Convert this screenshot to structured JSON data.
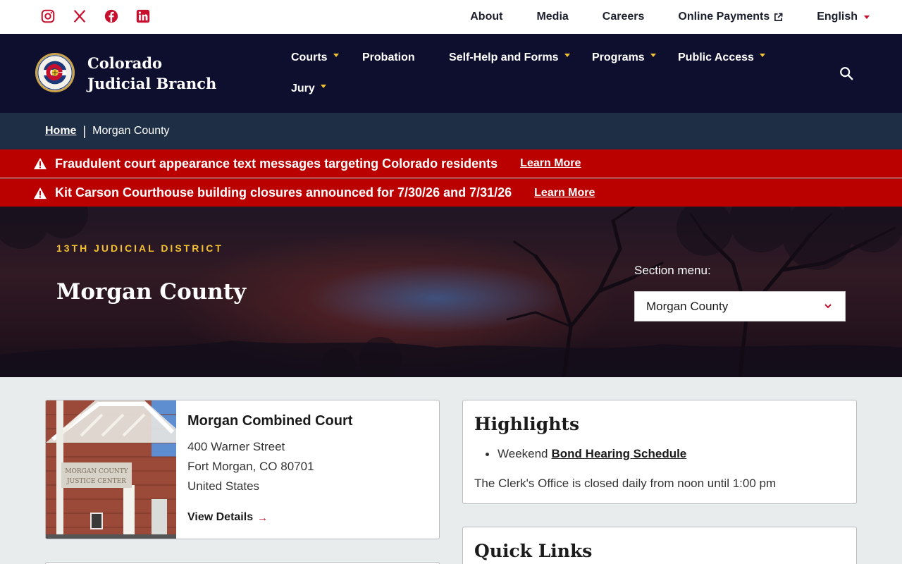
{
  "utility": {
    "social": [
      "instagram-icon",
      "x-icon",
      "facebook-icon",
      "linkedin-icon"
    ],
    "links": [
      "About",
      "Media",
      "Careers",
      "Online Payments",
      "English"
    ]
  },
  "header": {
    "brand": "Colorado Judicial Branch",
    "nav": {
      "courts": "Courts",
      "probation": "Probation",
      "self_help": "Self-Help and Forms",
      "programs": "Programs",
      "public_access": "Public Access",
      "jury": "Jury"
    }
  },
  "breadcrumb": {
    "home": "Home",
    "current": "Morgan County"
  },
  "alerts": [
    {
      "text": "Fraudulent court appearance text messages targeting Colorado residents",
      "link": "Learn More"
    },
    {
      "text": "Kit Carson Courthouse building closures announced for 7/30/26 and 7/31/26",
      "link": "Learn More"
    }
  ],
  "hero": {
    "district": "13TH JUDICIAL DISTRICT",
    "title": "Morgan County",
    "section_label": "Section menu:",
    "section_value": "Morgan County"
  },
  "court": {
    "name": "Morgan Combined Court",
    "address1": "400 Warner Street",
    "address2": "Fort Morgan, CO 80701",
    "address3": "United States",
    "view": "View Details",
    "sign_line1": "MORGAN COUNTY",
    "sign_line2": "JUSTICE CENTER"
  },
  "highlights": {
    "title": "Highlights",
    "item_prefix": "Weekend",
    "item_link": "Bond Hearing Schedule",
    "note": "The Clerk's Office is closed daily from noon until 1:00 pm"
  },
  "quick_links": {
    "title": "Quick Links"
  },
  "colors": {
    "navy": "#0e0f2e",
    "gold": "#f2c230",
    "alert_red": "#bb0000",
    "accent_red": "#c8102e"
  }
}
